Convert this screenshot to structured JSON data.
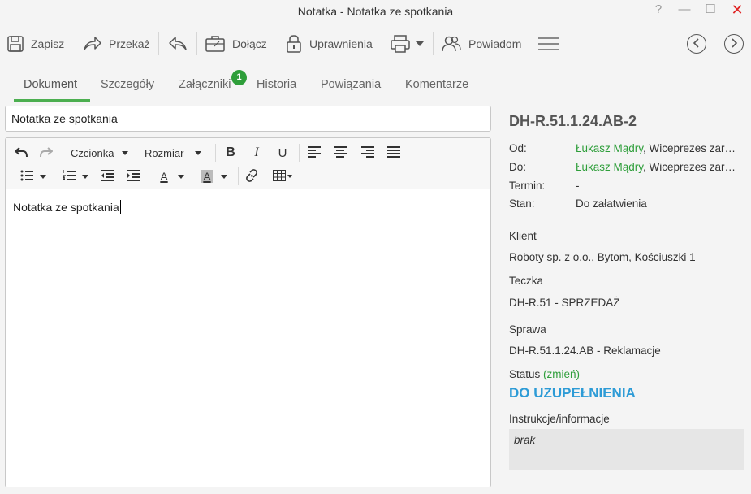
{
  "window": {
    "title": "Notatka - Notatka ze spotkania",
    "help": "?",
    "minimize": "—",
    "maximize": "☐",
    "close": "✕"
  },
  "toolbar": {
    "save": "Zapisz",
    "forward": "Przekaż",
    "attach": "Dołącz",
    "permissions": "Uprawnienia",
    "notify": "Powiadom"
  },
  "tabs": {
    "document": "Dokument",
    "details": "Szczegóły",
    "attachments": "Załączniki",
    "attachments_count": "1",
    "history": "Historia",
    "links": "Powiązania",
    "comments": "Komentarze"
  },
  "subject_value": "Notatka ze spotkania",
  "editor": {
    "font_label": "Czcionka",
    "size_label": "Rozmiar",
    "bold": "B",
    "italic": "I",
    "underline": "U",
    "font_color": "A",
    "bg_color": "A",
    "content": "Notatka ze spotkania"
  },
  "details": {
    "doc_id": "DH-R.51.1.24.AB-2",
    "from_label": "Od:",
    "from_name": "Łukasz Mądry",
    "from_rest": ", Wiceprezes zar…",
    "to_label": "Do:",
    "to_name": "Łukasz Mądry",
    "to_rest": ", Wiceprezes zar…",
    "deadline_label": "Termin:",
    "deadline_value": "-",
    "state_label": "Stan:",
    "state_value": "Do załatwienia",
    "client_label": "Klient",
    "client_value": "Roboty sp. z o.o., Bytom, Kościuszki 1",
    "folder_label": "Teczka",
    "folder_value": "DH-R.51 - SPRZEDAŻ",
    "case_label": "Sprawa",
    "case_value": "DH-R.51.1.24.AB - Reklamacje",
    "status_label": "Status",
    "status_change": "(zmień)",
    "status_value": "DO UZUPEŁNIENIA",
    "instructions_label": "Instrukcje/informacje",
    "instructions_value": "brak"
  },
  "colors": {
    "accent_green": "#2e9e3a",
    "status_blue": "#2d9bd6",
    "close_red": "#e02424"
  }
}
